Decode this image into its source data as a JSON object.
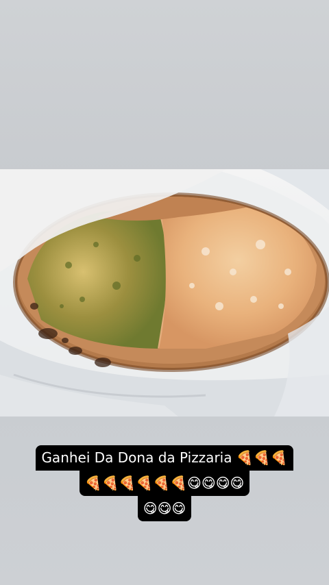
{
  "story": {
    "caption_lines": [
      "Ganhei Da Dona da Pizzaria 🍕🍕🍕",
      "🍕🍕🍕🍕🍕🍕😋😋😋😋",
      "😋😋😋"
    ]
  },
  "photo": {
    "subject": "pizza-in-paper-bag",
    "colors": {
      "crust": "#b57a4a",
      "crust_dark": "#6b3a1e",
      "pesto_half": "#a89a4a",
      "cheese_half": "#e6b98a",
      "bag": "#f2f2f2",
      "background": "#cbcfd3"
    }
  }
}
